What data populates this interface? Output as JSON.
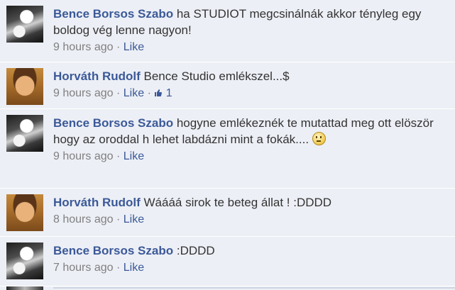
{
  "comments": [
    {
      "author": "Bence Borsos Szabo",
      "text": "ha STUDIOT megcsinálnák akkor tényleg egy boldog vég lenne nagyon!",
      "time": "9 hours ago",
      "separator": "·",
      "like_label": "Like",
      "avatar": "bw-photo"
    },
    {
      "author": "Horváth Rudolf",
      "text": "Bence Studio emlékszel...$",
      "time": "9 hours ago",
      "separator": "·",
      "like_label": "Like",
      "like_separator": "·",
      "like_icon": "thumbs-up-icon",
      "like_count": "1",
      "avatar": "face-photo"
    },
    {
      "author": "Bence Borsos Szabo",
      "text": "hogyne emlékeznék te mutattad meg ott elöször hogy az oroddal h lehet labdázni mint a fokák....",
      "emoji": "sad-face-icon",
      "time": "9 hours ago",
      "separator": "·",
      "like_label": "Like",
      "avatar": "bw-photo"
    },
    {
      "author": "Horváth Rudolf",
      "text": "Wáááá sirok te beteg állat ! :DDDD",
      "time": "8 hours ago",
      "separator": "·",
      "like_label": "Like",
      "avatar": "face-photo"
    },
    {
      "author": "Bence Borsos Szabo",
      "text": ":DDDD",
      "time": "7 hours ago",
      "separator": "·",
      "like_label": "Like",
      "avatar": "bw-photo"
    }
  ],
  "colors": {
    "link": "#3b5998",
    "meta": "#808080",
    "background": "#eceff5",
    "text": "#333333"
  }
}
